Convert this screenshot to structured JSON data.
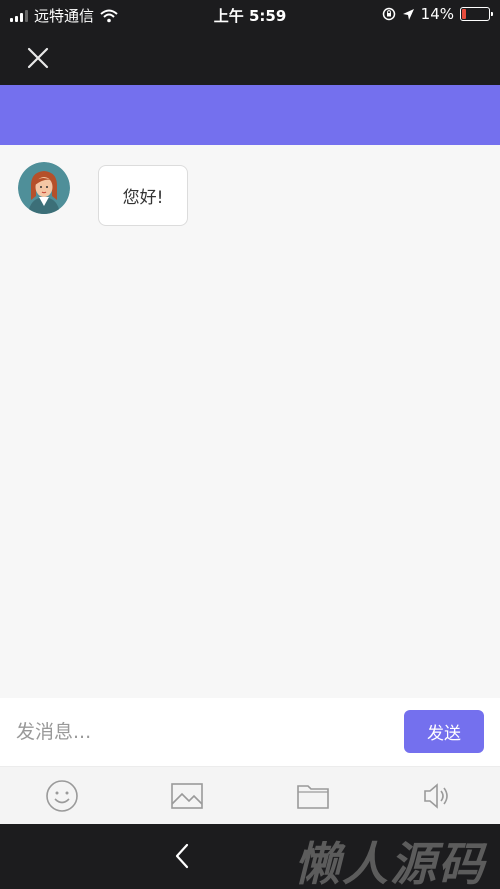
{
  "status_bar": {
    "carrier": "远特通信",
    "time": "上午 5:59",
    "battery": "14%",
    "battery_level": 0.14
  },
  "chat": {
    "messages": [
      {
        "sender": "agent",
        "text": "您好!"
      }
    ]
  },
  "composer": {
    "placeholder": "发消息...",
    "send_label": "发送"
  },
  "toolbar": {
    "icons": [
      "emoji-icon",
      "image-icon",
      "folder-icon",
      "speaker-icon"
    ]
  },
  "watermark": "懒人源码",
  "colors": {
    "accent": "#7470ee",
    "dark_bar": "#1c1c1e",
    "chat_bg": "#f7f7f7"
  }
}
